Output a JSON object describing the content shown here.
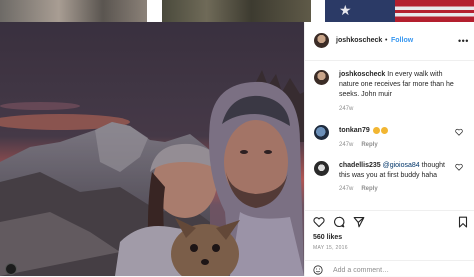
{
  "strip": {
    "thumbs": [
      "thumbnail-1",
      "thumbnail-2",
      "thumbnail-3"
    ]
  },
  "post": {
    "owner": "joshkoscheck",
    "follow_label": "Follow",
    "separator": "•",
    "more_icon": "ellipsis-icon",
    "caption_user": "joshkoscheck",
    "caption_text": "In every walk with nature one receives far more than he seeks. John muir",
    "caption_age": "247w",
    "comments": [
      {
        "user": "tonkan79",
        "text": "",
        "emojis": [
          "thumbs-up",
          "thumbs-up"
        ],
        "age": "247w",
        "reply": "Reply"
      },
      {
        "user": "chadellis235",
        "mention": "@gioiosa84",
        "text": "thought this was you at first buddy haha",
        "age": "247w",
        "reply": "Reply"
      }
    ],
    "likes": "560 likes",
    "date": "MAY 15, 2016",
    "add_comment_placeholder": "Add a comment…",
    "icons": [
      "heart-icon",
      "comment-icon",
      "share-icon",
      "bookmark-icon"
    ]
  },
  "colors": {
    "link_blue": "#3897f0",
    "mention_blue": "#003569",
    "muted": "#8e8e8e",
    "border": "#efefef"
  }
}
